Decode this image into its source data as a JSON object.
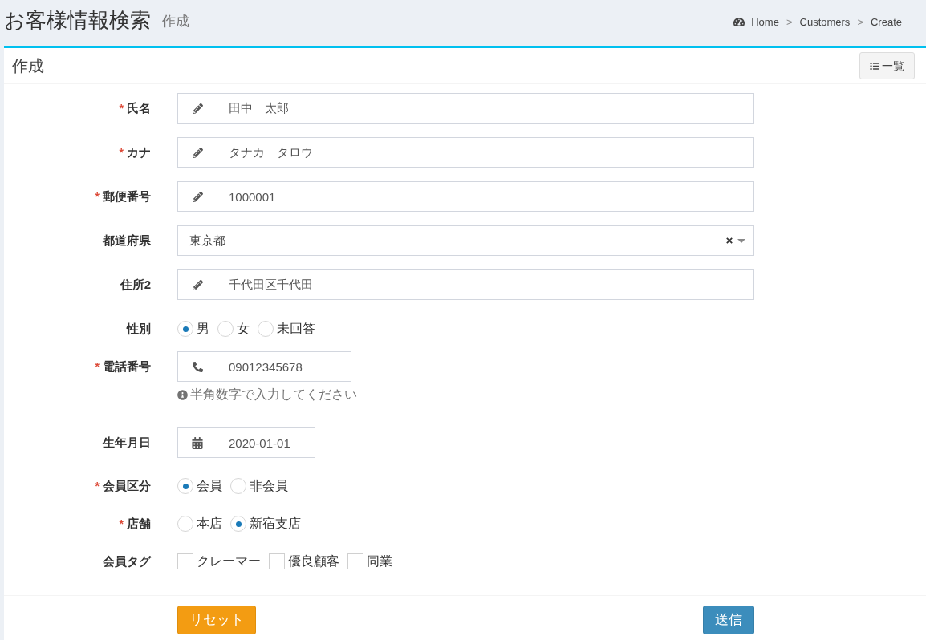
{
  "header": {
    "title": "お客様情報検索",
    "subtitle": "作成"
  },
  "breadcrumb": [
    {
      "kind": "home",
      "label": "Home"
    },
    {
      "kind": "separator",
      "label": ">"
    },
    {
      "kind": "link",
      "label": "Customers"
    },
    {
      "kind": "separator",
      "label": ">"
    },
    {
      "kind": "current",
      "label": "Create"
    }
  ],
  "box": {
    "title": "作成",
    "list_button": "一覧"
  },
  "form": {
    "fields": [
      {
        "kind": "text",
        "required_mark": "*",
        "label": "氏名",
        "value": "田中　太郎"
      },
      {
        "kind": "text",
        "required_mark": "*",
        "label": "カナ",
        "value": "タナカ　タロウ"
      },
      {
        "kind": "text",
        "required_mark": "*",
        "label": "郵便番号",
        "value": "1000001"
      },
      {
        "kind": "select",
        "label": "都道府県",
        "value": "東京都"
      },
      {
        "kind": "text",
        "label": "住所2",
        "value": "千代田区千代田"
      },
      {
        "kind": "radio",
        "label": "性別",
        "options": [
          {
            "label": "男",
            "selected": true
          },
          {
            "label": "女",
            "selected": false
          },
          {
            "label": "未回答",
            "selected": false
          }
        ]
      },
      {
        "kind": "tel",
        "required_mark": "*",
        "label": "電話番号",
        "value": "09012345678",
        "help": "半角数字で入力してください"
      },
      {
        "kind": "date",
        "label": "生年月日",
        "value": "2020-01-01"
      },
      {
        "kind": "radio",
        "required_mark": "*",
        "label": "会員区分",
        "options": [
          {
            "label": "会員",
            "selected": true
          },
          {
            "label": "非会員",
            "selected": false
          }
        ]
      },
      {
        "kind": "radio",
        "required_mark": "*",
        "label": "店舗",
        "options": [
          {
            "label": "本店",
            "selected": false
          },
          {
            "label": "新宿支店",
            "selected": true
          }
        ]
      },
      {
        "kind": "checkbox",
        "label": "会員タグ",
        "options": [
          {
            "label": "クレーマー",
            "checked": false
          },
          {
            "label": "優良顧客",
            "checked": false
          },
          {
            "label": "同業",
            "checked": false
          }
        ]
      }
    ]
  },
  "buttons": [
    {
      "kind": "reset",
      "label": "リセット"
    },
    {
      "kind": "submit",
      "label": "送信"
    }
  ]
}
